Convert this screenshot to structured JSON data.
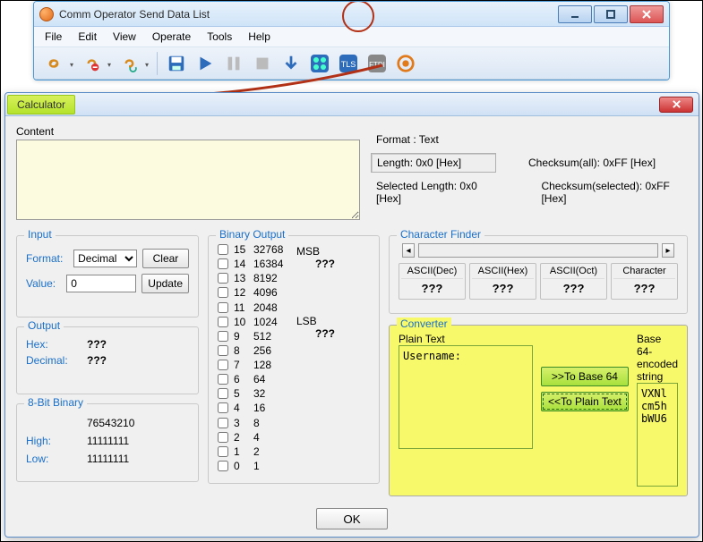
{
  "window": {
    "title": "Comm Operator     Send Data List",
    "menu": [
      "File",
      "Edit",
      "View",
      "Operate",
      "Tools",
      "Help"
    ],
    "toolbar_icons": [
      "link-icon",
      "link-remove-icon",
      "link-refresh-icon",
      "save-icon",
      "play-icon",
      "pause-icon",
      "stop-icon",
      "download-icon",
      "calculator-icon",
      "tls-icon",
      "ftdi-icon",
      "target-icon"
    ]
  },
  "dialog": {
    "title": "Calculator",
    "content_label": "Content",
    "format": {
      "label": "Format : Text",
      "length": "Length:  0x0 [Hex]",
      "checksum_all": "Checksum(all):  0xFF [Hex]",
      "selected_length": "Selected Length:  0x0 [Hex]",
      "checksum_selected": "Checksum(selected):  0xFF [Hex]"
    },
    "input": {
      "legend": "Input",
      "format_label": "Format:",
      "format_value": "Decimal",
      "clear": "Clear",
      "value_label": "Value:",
      "value": "0",
      "update": "Update"
    },
    "output": {
      "legend": "Output",
      "hex_label": "Hex:",
      "hex_val": "???",
      "dec_label": "Decimal:",
      "dec_val": "???"
    },
    "eightbit": {
      "legend": "8-Bit Binary",
      "header": "76543210",
      "high_label": "High:",
      "high_val": "11111111",
      "low_label": "Low:",
      "low_val": "11111111"
    },
    "binary_output": {
      "legend": "Binary Output",
      "msb": "MSB",
      "lsb": "LSB",
      "q": "???",
      "bits": [
        {
          "i": "15",
          "w": "32768"
        },
        {
          "i": "14",
          "w": "16384"
        },
        {
          "i": "13",
          "w": "8192"
        },
        {
          "i": "12",
          "w": "4096"
        },
        {
          "i": "11",
          "w": "2048"
        },
        {
          "i": "10",
          "w": "1024"
        },
        {
          "i": "9",
          "w": "512"
        },
        {
          "i": "8",
          "w": "256"
        },
        {
          "i": "7",
          "w": "128"
        },
        {
          "i": "6",
          "w": "64"
        },
        {
          "i": "5",
          "w": "32"
        },
        {
          "i": "4",
          "w": "16"
        },
        {
          "i": "3",
          "w": "8"
        },
        {
          "i": "2",
          "w": "4"
        },
        {
          "i": "1",
          "w": "2"
        },
        {
          "i": "0",
          "w": "1"
        }
      ]
    },
    "char_finder": {
      "legend": "Character Finder",
      "cols": [
        "ASCII(Dec)",
        "ASCII(Hex)",
        "ASCII(Oct)",
        "Character"
      ],
      "val": "???"
    },
    "converter": {
      "legend": "Converter",
      "plain_label": "Plain Text",
      "b64_label": "Base 64-encoded string",
      "plain_value": "Username:",
      "b64_value": "VXNlcm5hbWU6",
      "to_b64": ">>To Base 64",
      "to_plain": "<<To Plain Text"
    },
    "ok": "OK"
  }
}
